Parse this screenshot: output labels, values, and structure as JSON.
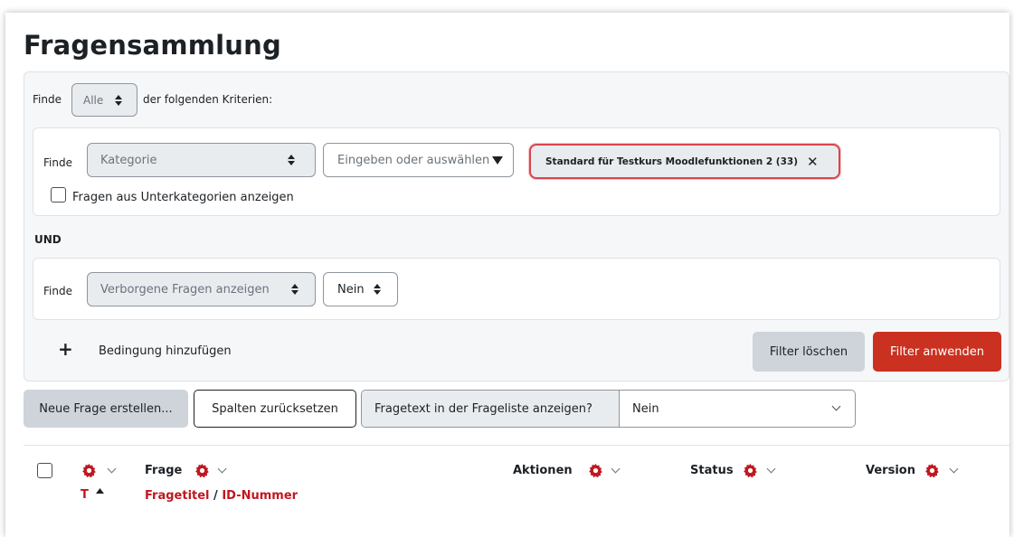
{
  "page": {
    "title": "Fragensammlung"
  },
  "filter": {
    "finde_label": "Finde",
    "match_select": "Alle",
    "criteria_text": "der folgenden Kriterien:",
    "conditions": [
      {
        "finde_label": "Finde",
        "type": "Kategorie",
        "search_placeholder": "Eingeben oder auswählen",
        "chip": "Standard für Testkurs Moodlefunktionen 2 (33)",
        "subcategories_label": "Fragen aus Unterkategorien anzeigen"
      },
      {
        "finde_label": "Finde",
        "type": "Verborgene Fragen anzeigen",
        "value": "Nein"
      }
    ],
    "joiner": "UND",
    "add_condition_icon": "+",
    "add_condition_label": "Bedingung hinzufügen",
    "clear_button": "Filter löschen",
    "apply_button": "Filter anwenden"
  },
  "toolbar": {
    "new_question": "Neue Frage erstellen...",
    "reset_columns": "Spalten zurücksetzen",
    "show_text_label": "Fragetext in der Frageliste anzeigen?",
    "show_text_value": "Nein"
  },
  "table": {
    "headers": {
      "type_sort": "T",
      "question": "Frage",
      "question_sub_title": "Fragetitel",
      "question_sub_sep": "/",
      "question_sub_id": "ID-Nummer",
      "actions": "Aktionen",
      "status": "Status",
      "version": "Version"
    }
  },
  "colors": {
    "accent_red": "#ca3120",
    "link_red": "#c0171f",
    "chip_border": "#d9454e"
  }
}
